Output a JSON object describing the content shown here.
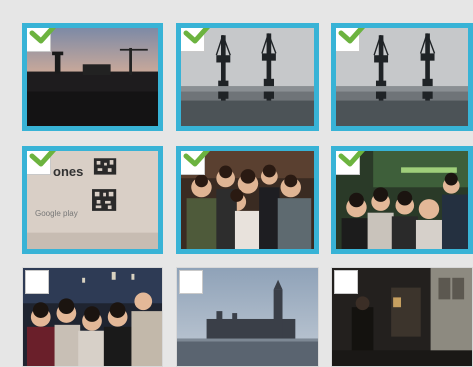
{
  "gallery": {
    "colors": {
      "selected_border": "#38b3d6",
      "checkmark": "#6cb33f",
      "background": "#e6e6e6"
    },
    "tiles": [
      {
        "id": "photo-1",
        "subject": "sunset-rooftops",
        "selected": true
      },
      {
        "id": "photo-2",
        "subject": "dock-cranes",
        "selected": true
      },
      {
        "id": "photo-3",
        "subject": "dock-cranes-duplicate",
        "selected": true
      },
      {
        "id": "photo-4",
        "subject": "qr-code-card",
        "selected": true,
        "card_text": "ones",
        "card_subtext": "Google play"
      },
      {
        "id": "photo-5",
        "subject": "group-photo-party",
        "selected": true
      },
      {
        "id": "photo-6",
        "subject": "group-photo-bar",
        "selected": true
      },
      {
        "id": "photo-7",
        "subject": "friends-night",
        "selected": false
      },
      {
        "id": "photo-8",
        "subject": "westminster-skyline",
        "selected": false
      },
      {
        "id": "photo-9",
        "subject": "dark-street",
        "selected": false
      }
    ]
  }
}
